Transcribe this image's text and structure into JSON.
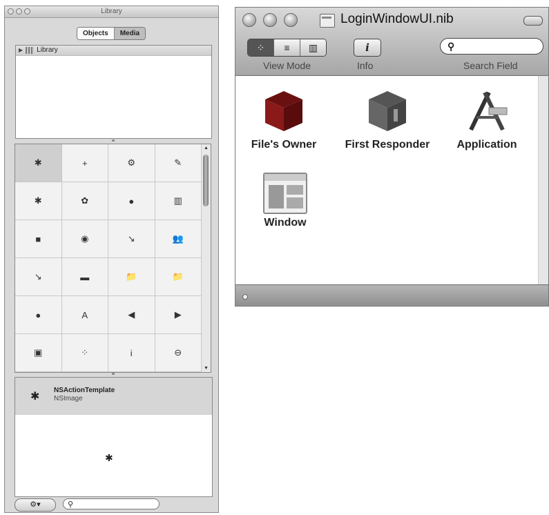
{
  "library": {
    "title": "Library",
    "tabs": [
      "Objects",
      "Media"
    ],
    "outline_root": "Library",
    "grid_icons": [
      [
        "✱",
        "+",
        "⚙",
        "✎"
      ],
      [
        "✱",
        "✿",
        "●",
        "▥"
      ],
      [
        "■",
        "◉",
        "↘",
        "👥"
      ],
      [
        "↘",
        "▬",
        "📁",
        "📁"
      ],
      [
        "●",
        "A",
        "◀",
        "▶"
      ],
      [
        "▣",
        "⁘",
        "i",
        "⊖"
      ]
    ],
    "selected_item": {
      "name": "NSActionTemplate",
      "class": "NSImage"
    },
    "bottom": {
      "gear_label": "⚙▾",
      "search_icon": "⚲"
    }
  },
  "nib": {
    "title": "LoginWindowUI.nib",
    "toolbar": {
      "view_mode_label": "View Mode",
      "info_label": "Info",
      "search_label": "Search Field",
      "search_icon": "⚲",
      "info_glyph": "i",
      "view_mode_glyphs": [
        "⁘",
        "≡",
        "▥"
      ]
    },
    "objects": [
      {
        "label": "File's Owner"
      },
      {
        "label": "First Responder"
      },
      {
        "label": "Application"
      },
      {
        "label": "Window"
      }
    ]
  },
  "colors": {
    "cube_dark": "#8a1a1a",
    "cube_face": "#555555"
  }
}
